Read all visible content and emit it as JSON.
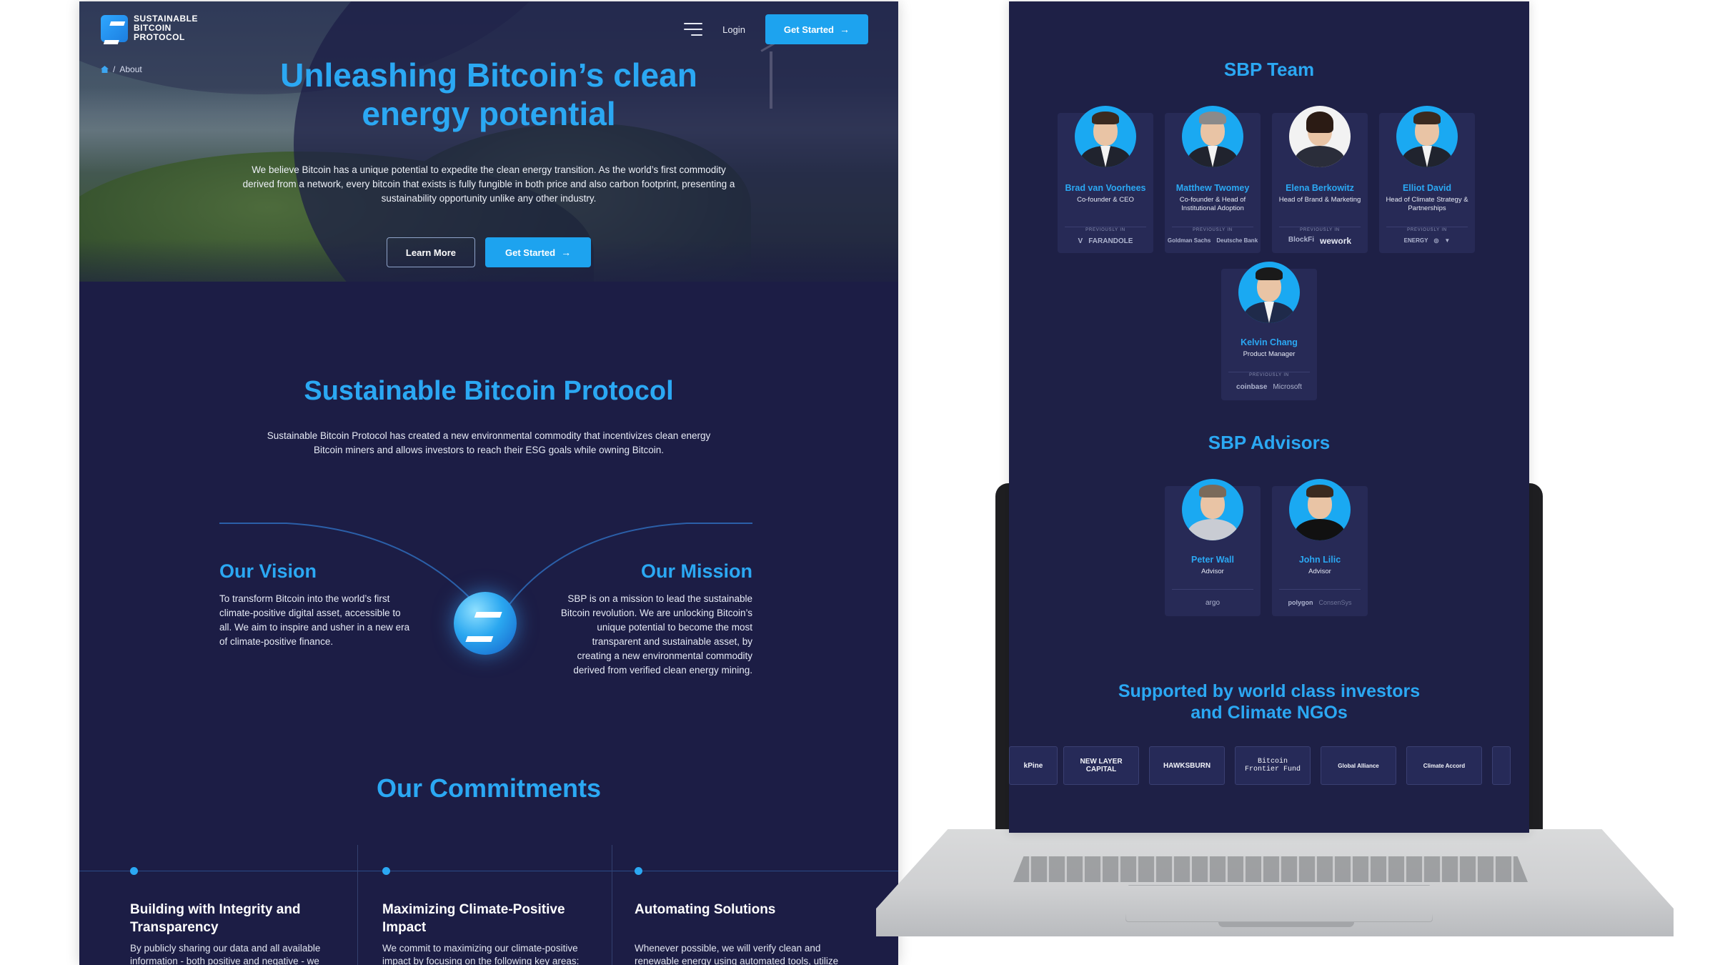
{
  "left_page": {
    "logo": {
      "text": "SUSTAINABLE BITCOIN PROTOCOL",
      "icon": "sbp-logo-icon"
    },
    "nav": {
      "login": "Login",
      "get_started": "Get Started",
      "menu_icon": "hamburger-menu-icon"
    },
    "breadcrumb": {
      "separator": "/",
      "current": "About",
      "home_icon": "home-icon"
    },
    "hero": {
      "title": "Unleashing Bitcoin’s clean energy potential",
      "description": "We believe Bitcoin has a unique potential to expedite the clean energy transition. As the world’s first commodity derived from a network, every bitcoin that exists is fully fungible in both price and also carbon footprint, presenting a sustainability opportunity unlike any other industry.",
      "learn_more": "Learn More",
      "get_started": "Get Started"
    },
    "sbp_section": {
      "title": "Sustainable Bitcoin Protocol",
      "description": "Sustainable Bitcoin Protocol has created a new environmental commodity that incentivizes clean energy Bitcoin miners and allows investors to reach their ESG goals while owning Bitcoin."
    },
    "vision": {
      "title": "Our Vision",
      "text": "To transform Bitcoin into the world’s first climate-positive digital asset, accessible to all. We aim to inspire and usher in a new era of climate-positive finance."
    },
    "mission": {
      "title": "Our Mission",
      "text": "SBP is on a mission to lead the sustainable Bitcoin revolution. We are unlocking Bitcoin’s unique potential to become the most transparent and sustainable asset, by creating a new environmental commodity derived from verified clean energy mining."
    },
    "commitments": {
      "title": "Our Commitments",
      "items": [
        {
          "title": "Building with Integrity and Transparency",
          "text": "By publicly sharing our data and all available information - both positive and negative - we"
        },
        {
          "title": "Maximizing Climate-Positive Impact",
          "text": "We commit to maximizing our climate-positive impact by focusing on the following key areas:"
        },
        {
          "title": "Automating Solutions",
          "text": "Whenever possible, we will verify clean and renewable energy using automated tools, utilize on-chain activity, and leverage API"
        }
      ]
    }
  },
  "right_page": {
    "team_title": "SBP Team",
    "previously_label": "PREVIOUSLY IN",
    "team": [
      {
        "name": "Brad van Voorhees",
        "role": "Co-founder & CEO",
        "logos": [
          "V",
          "FARANDOLE"
        ]
      },
      {
        "name": "Matthew Twomey",
        "role": "Co-founder & Head of Institutional Adoption",
        "logos": [
          "Goldman Sachs",
          "Deutsche Bank"
        ]
      },
      {
        "name": "Elena Berkowitz",
        "role": "Head of Brand & Marketing",
        "logos": [
          "BlockFi",
          "wework"
        ]
      },
      {
        "name": "Elliot David",
        "role": "Head of Climate Strategy & Partnerships",
        "logos": [
          "ENERGY",
          "◎",
          "▼"
        ]
      },
      {
        "name": "Kelvin Chang",
        "role": "Product Manager",
        "logos": [
          "coinbase",
          "Microsoft"
        ]
      }
    ],
    "advisors_title": "SBP Advisors",
    "advisors": [
      {
        "name": "Peter Wall",
        "role": "Advisor",
        "logos": [
          "argo"
        ]
      },
      {
        "name": "John Lilic",
        "role": "Advisor",
        "logos": [
          "polygon",
          "ConsenSys"
        ]
      }
    ],
    "investors_title": "Supported by world class investors and Climate NGOs",
    "investors": [
      "kPine",
      "NEW LAYER CAPITAL",
      "HAWKSBURN",
      "Bitcoin Frontier Fund",
      "Global Alliance",
      "Climate Accord"
    ]
  },
  "colors": {
    "background": "#1c1d45",
    "accent": "#2ba8f3",
    "button": "#1da3ef",
    "card": "#272a56"
  }
}
